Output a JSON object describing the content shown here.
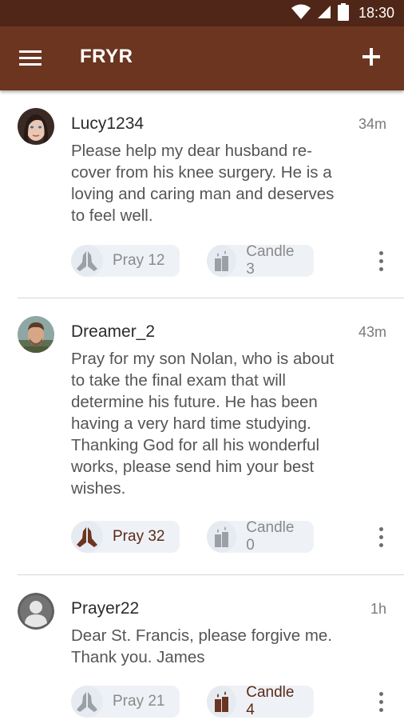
{
  "status_bar": {
    "time": "18:30"
  },
  "app_bar": {
    "title": "FRYR"
  },
  "posts": [
    {
      "username": "Lucy1234",
      "time_ago": "34m",
      "text": "Please help my dear husband re-cover from his knee surgery. He is a loving and caring man and deserves to feel well.",
      "pray_label": "Pray 12",
      "candle_label": "Candle 3",
      "prayed": false,
      "candled": false,
      "avatar": "woman-photo"
    },
    {
      "username": "Dreamer_2",
      "time_ago": "43m",
      "text": "Pray for my son Nolan, who is about to take the final exam that will determine his future. He has been having a very hard time studying. Thanking God for all his wonderful works, please send him your best wishes.",
      "pray_label": "Pray 32",
      "candle_label": "Candle 0",
      "prayed": true,
      "candled": false,
      "avatar": "man-photo"
    },
    {
      "username": "Prayer22",
      "time_ago": "1h",
      "text": "Dear St. Francis, please forgive me. Thank you. James",
      "pray_label": "Pray 21",
      "candle_label": "Candle 4",
      "prayed": false,
      "candled": true,
      "avatar": "default-person"
    }
  ],
  "colors": {
    "status_bar": "#4f2617",
    "app_bar": "#6b3520",
    "active_icon": "#6b3520",
    "inactive_icon": "#9aa0a6"
  }
}
